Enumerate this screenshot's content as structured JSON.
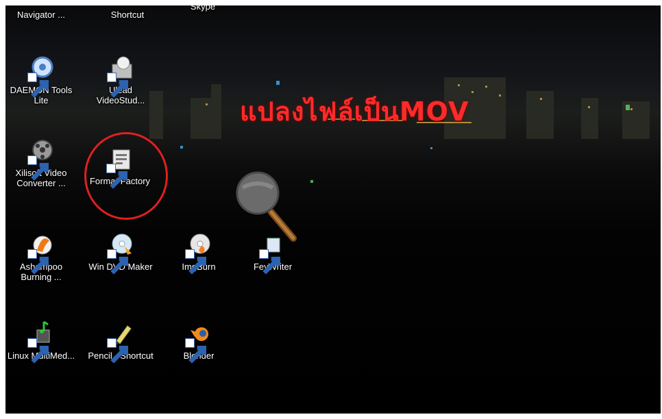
{
  "desktop": {
    "overlay_text": "แปลงไฟล์เป็นMOV",
    "accent_color": "#e02020",
    "icons_top_row": [
      {
        "label": "Navigator ...",
        "name": "navigator-shortcut"
      },
      {
        "label": "Shortcut",
        "name": "files-shortcut"
      },
      {
        "label": "Skype",
        "name": "skype-shortcut"
      }
    ],
    "icons": [
      {
        "label": "DAEMON Tools Lite",
        "icon": "daemon-tools-icon"
      },
      {
        "label": "Ulead VideoStud...",
        "icon": "ulead-videostudio-icon"
      },
      {
        "label": "Xilisoft Video Converter ...",
        "icon": "xilisoft-converter-icon"
      },
      {
        "label": "Format Factory",
        "icon": "format-factory-icon"
      },
      {
        "label": "Ashampoo Burning ...",
        "icon": "ashampoo-burning-icon"
      },
      {
        "label": "Win DVD Maker",
        "icon": "dvd-maker-icon"
      },
      {
        "label": "ImgBurn",
        "icon": "imgburn-icon"
      },
      {
        "label": "FeyWriter",
        "icon": "feywriter-icon"
      },
      {
        "label": "Linux MultiMed...",
        "icon": "linux-multimedia-icon"
      },
      {
        "label": "Pencil - Shortcut",
        "icon": "pencil-icon"
      },
      {
        "label": "Blender",
        "icon": "blender-icon"
      }
    ]
  }
}
